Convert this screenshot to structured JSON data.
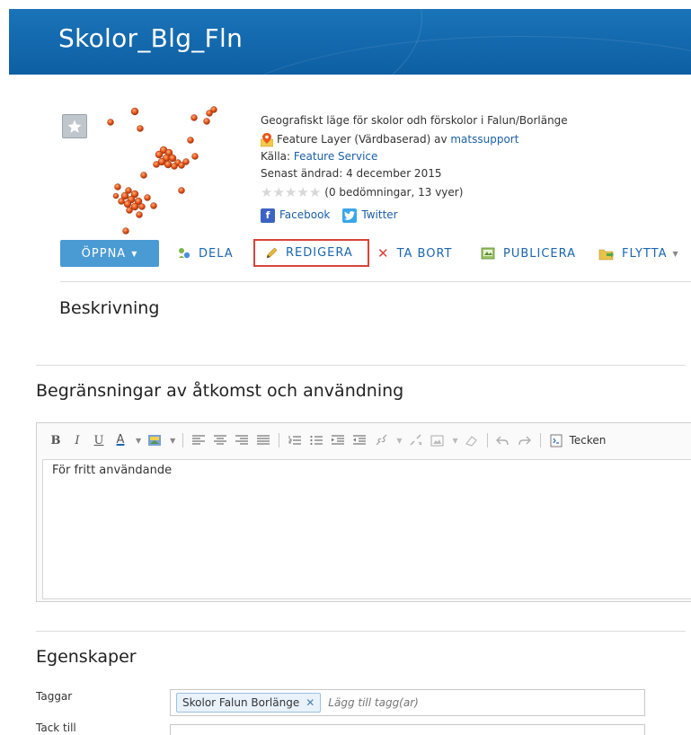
{
  "header": {
    "title": "Skolor_Blg_Fln"
  },
  "item": {
    "description": "Geografiskt läge för skolor odh förskolor i Falun/Borlänge",
    "type_text": "Feature Layer (Värdbaserad) av ",
    "owner": "matssupport",
    "source_label": "Källa: ",
    "source_value": "Feature Service",
    "modified": "Senast ändrad: 4 december 2015",
    "rating_text": "(0 bedömningar, 13 vyer)",
    "facebook": "Facebook",
    "twitter": "Twitter"
  },
  "actions": {
    "open": "ÖPPNA",
    "share": "DELA",
    "edit": "REDIGERA",
    "delete": "TA BORT",
    "publish": "PUBLICERA",
    "move": "FLYTTA"
  },
  "sections": {
    "description": "Beskrivning",
    "access": "Begränsningar av åtkomst och användning",
    "properties": "Egenskaper"
  },
  "editor": {
    "toolbar_font_label": "Tecken",
    "content": "För fritt användande"
  },
  "properties": {
    "tags_label": "Taggar",
    "tag": "Skolor Falun Borlänge",
    "tag_placeholder": "Lägg till tagg(ar)",
    "credits_label": "Tack till"
  },
  "colors": {
    "header_bg": "#0e5fa3",
    "accent": "#1a66b0",
    "open_button": "#4a9ad4",
    "edit_highlight": "#d9433a",
    "delete_icon": "#d9433a"
  }
}
